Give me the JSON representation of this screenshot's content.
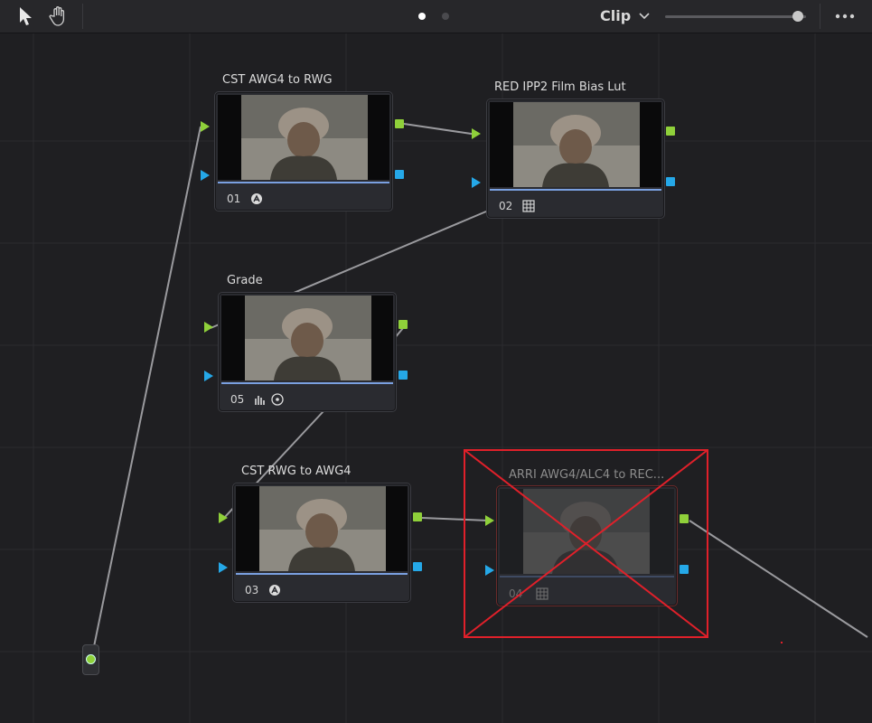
{
  "toolbar": {
    "clip_label": "Clip",
    "zoom_level": 0.94,
    "page_dots": [
      {
        "state": "active",
        "color": "#ffffff"
      },
      {
        "state": "inactive",
        "color": "#4a4a4e"
      }
    ],
    "icons": [
      "pointer-icon",
      "hand-icon",
      "chevron-down-icon",
      "more-options-icon"
    ]
  },
  "nodes": [
    {
      "label": "CST AWG4 to RWG",
      "number": "01",
      "icon": "color-space-transform-icon"
    },
    {
      "label": "RED IPP2 Film Bias Lut",
      "number": "02",
      "icon": "lut-grid-icon"
    },
    {
      "label": "Grade",
      "number": "05",
      "icon": "curves-and-target-icon"
    },
    {
      "label": "CST RWG  to AWG4",
      "number": "03",
      "icon": "color-space-transform-icon"
    },
    {
      "label": "ARRI AWG4/ALC4 to REC...",
      "number": "04",
      "icon": "lut-grid-icon",
      "state": "disabled"
    }
  ],
  "colors": {
    "rgb_output": "#8fd03a",
    "alpha_port": "#25a8e8",
    "disabled_mark": "#e0202a",
    "connection_line": "#9a9a9e"
  }
}
